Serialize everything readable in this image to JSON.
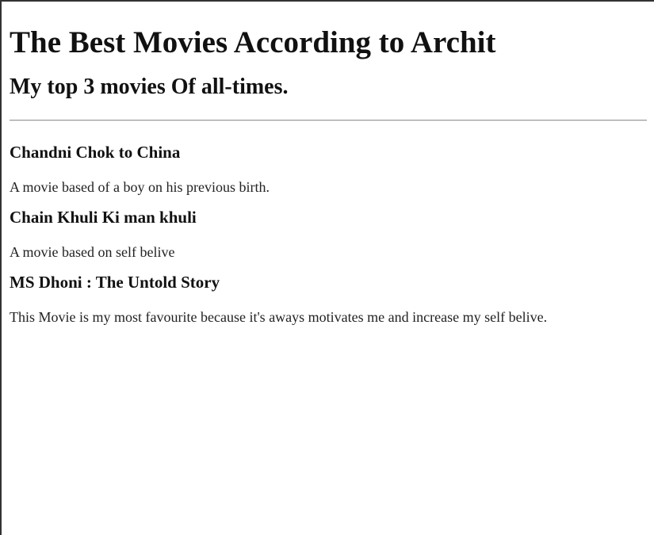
{
  "page": {
    "heading": "The Best Movies According to Archit",
    "subheading": "My top 3 movies Of all-times."
  },
  "movies": [
    {
      "title": "Chandni Chok to China",
      "description": "A movie based of a boy on his previous birth."
    },
    {
      "title": "Chain Khuli Ki man khuli",
      "description": "A movie based on self belive"
    },
    {
      "title": "MS Dhoni : The Untold Story",
      "description": "This Movie is my most favourite because it's aways motivates me and increase my self belive."
    }
  ]
}
